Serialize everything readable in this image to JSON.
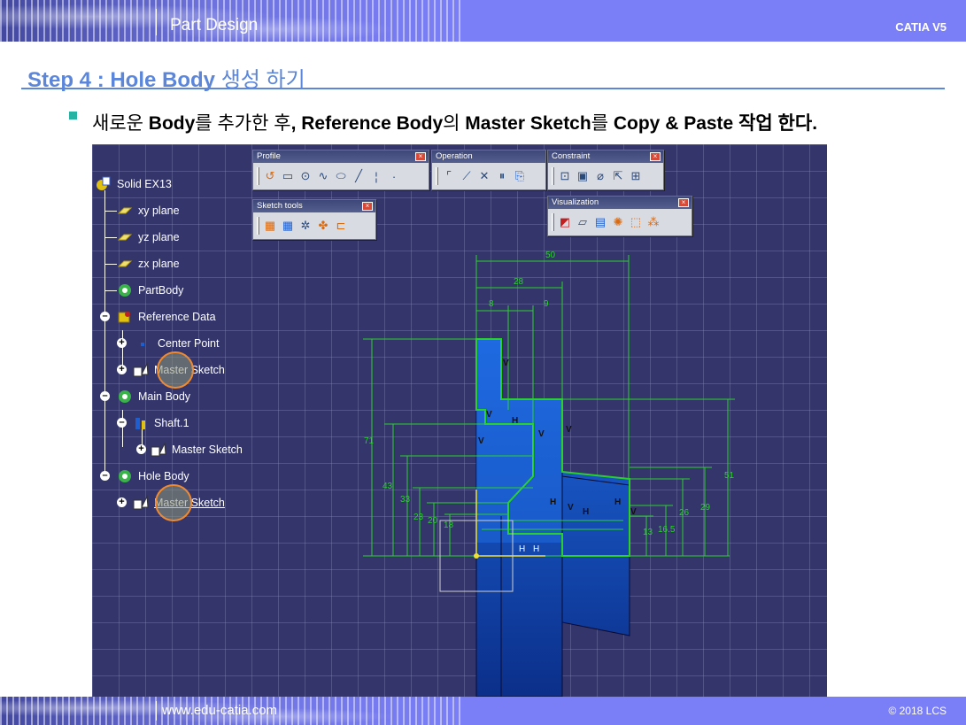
{
  "header": {
    "title": "Part Design",
    "product": "CATIA V5"
  },
  "footer": {
    "website": "www.edu-catia.com",
    "copyright": "© 2018 LCS"
  },
  "step": {
    "title_en": "Step 4 : Hole Body",
    "title_ko": "생성 하기"
  },
  "bullet": {
    "parts": [
      {
        "text": "새로운 ",
        "bold": false
      },
      {
        "text": "Body",
        "bold": true
      },
      {
        "text": "를 추가한 후",
        "bold": false
      },
      {
        "text": ", Reference Body",
        "bold": true
      },
      {
        "text": "의 ",
        "bold": false
      },
      {
        "text": "Master Sketch",
        "bold": true
      },
      {
        "text": "를 ",
        "bold": false
      },
      {
        "text": "Copy & Paste ",
        "bold": true
      },
      {
        "text": "작업 한다.",
        "bold": true
      }
    ]
  },
  "tree": {
    "root": "Solid EX13",
    "items": [
      {
        "label": "xy plane"
      },
      {
        "label": "yz plane"
      },
      {
        "label": "zx plane"
      },
      {
        "label": "PartBody"
      },
      {
        "label": "Reference Data"
      },
      {
        "label": "Center Point"
      },
      {
        "label": "Master Sketch"
      },
      {
        "label": "Main Body"
      },
      {
        "label": "Shaft.1"
      },
      {
        "label": "Master Sketch"
      },
      {
        "label": "Hole Body"
      },
      {
        "label": "Master Sketch"
      }
    ]
  },
  "toolbars": {
    "profile": "Profile",
    "operation": "Operation",
    "constraint": "Constraint",
    "sketch_tools": "Sketch tools",
    "visualization": "Visualization"
  },
  "dimensions": {
    "top": [
      "50",
      "28",
      "8",
      "9"
    ],
    "left": [
      "71",
      "43",
      "33",
      "23",
      "20",
      "18"
    ],
    "right": [
      "51",
      "29",
      "26",
      "16.5",
      "13"
    ],
    "constraint_letters": [
      "V",
      "H"
    ]
  },
  "colors": {
    "band": "#7b7ff7",
    "title_blue": "#5b86d9",
    "bullet": "#25b4a4",
    "viewport_bg": "#33356b",
    "sketch_green": "#2bd12b",
    "part_blue": "#1f6ae0",
    "highlight_circle": "#f08a30"
  }
}
